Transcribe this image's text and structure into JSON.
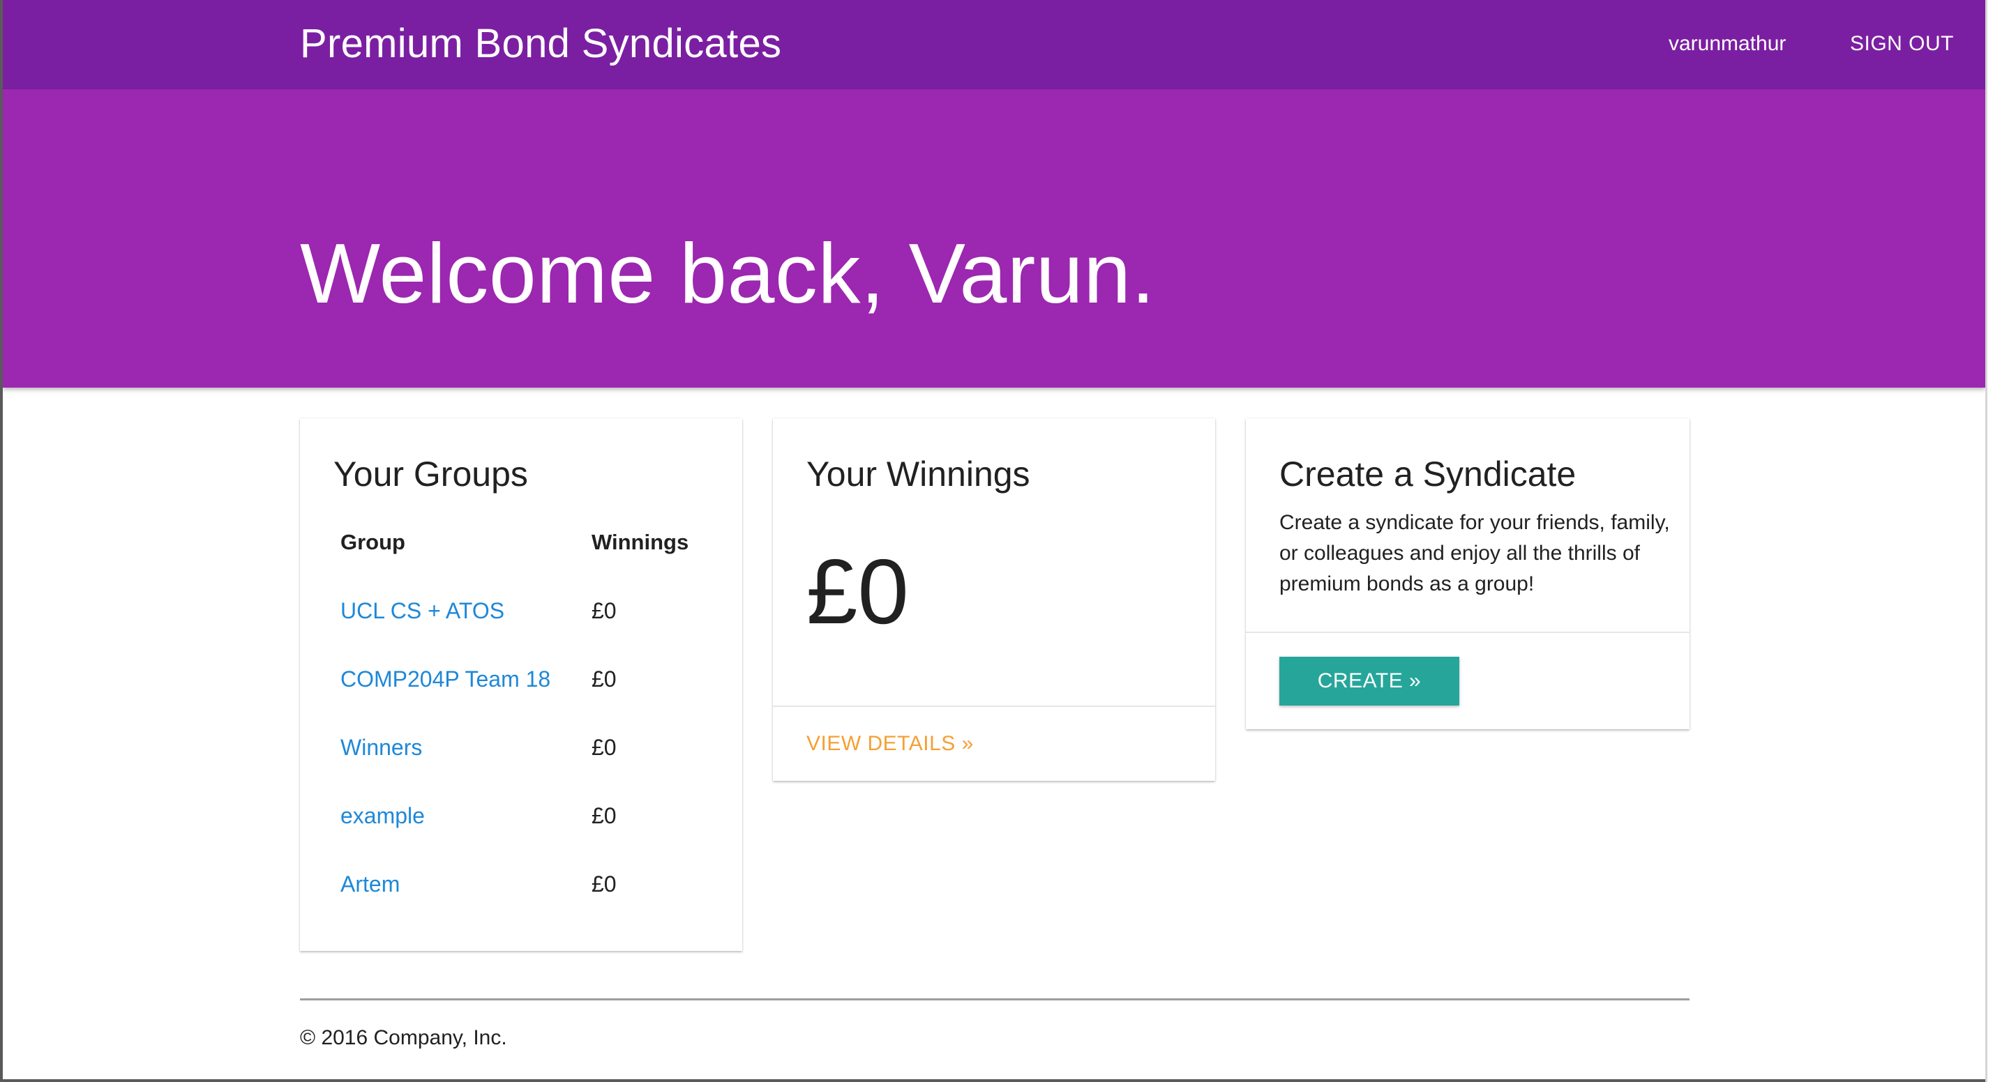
{
  "header": {
    "brand": "Premium Bond Syndicates",
    "username": "varunmathur",
    "signout_label": "SIGN OUT"
  },
  "hero": {
    "title": "Welcome back, Varun."
  },
  "groups_card": {
    "title": "Your Groups",
    "col_group": "Group",
    "col_winnings": "Winnings",
    "rows": [
      {
        "name": "UCL CS + ATOS",
        "winnings": "£0"
      },
      {
        "name": "COMP204P Team 18",
        "winnings": "£0"
      },
      {
        "name": "Winners",
        "winnings": "£0"
      },
      {
        "name": "example",
        "winnings": "£0"
      },
      {
        "name": "Artem",
        "winnings": "£0"
      }
    ]
  },
  "winnings_card": {
    "title": "Your Winnings",
    "amount": "£0",
    "link_label": "VIEW DETAILS »"
  },
  "create_card": {
    "title": "Create a Syndicate",
    "description": "Create a syndicate for your friends, family, or colleagues and enjoy all the thrills of premium bonds as a group!",
    "button_label": "CREATE »"
  },
  "footer": {
    "copyright": "© 2016 Company, Inc."
  },
  "colors": {
    "navbar": "#7b1fa2",
    "hero": "#9c27b0",
    "link": "#1e88d8",
    "accent_orange": "#f5a035",
    "button_teal": "#26a69a"
  }
}
